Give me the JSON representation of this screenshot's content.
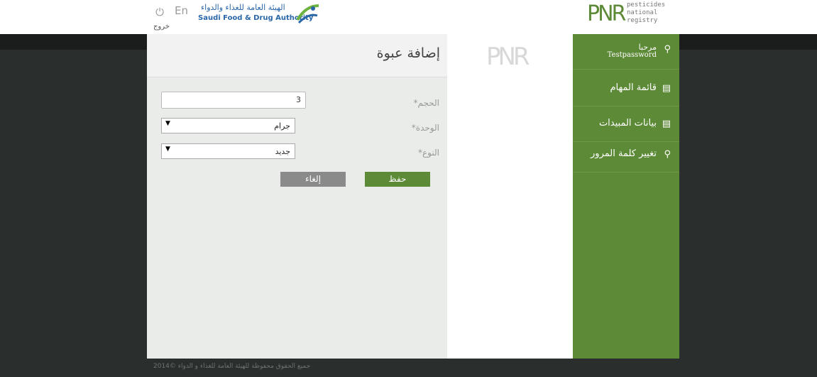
{
  "header": {
    "power_icon": "power-icon",
    "language_label": "En",
    "logout_label": "خروج",
    "sfda_name_ar": "الهيئة العامة للغذاء والدواء",
    "sfda_name_en": "Saudi Food & Drug Authority",
    "pnr_mark": "PNR",
    "pnr_words": [
      "pesticides",
      "national",
      "registry"
    ]
  },
  "sidebar": {
    "welcome_ar": "مرحبا",
    "welcome_user": "Testpassword",
    "items": [
      {
        "label": "قائمة المهام",
        "icon": "list-icon"
      },
      {
        "label": "بيانات المبيدات",
        "icon": "list-icon"
      },
      {
        "label": "تغيير كلمة المرور",
        "icon": "key-icon"
      }
    ]
  },
  "form": {
    "title": "إضافة عبوة",
    "fields": [
      {
        "label": "الحجم*",
        "value": "3"
      },
      {
        "label": "الوحدة*",
        "value": "جرام"
      },
      {
        "label": "النوع*",
        "value": "جديد"
      }
    ],
    "save_label": "حفظ",
    "cancel_label": "إلغاء"
  },
  "watermark": "PNR",
  "footer": {
    "copyright": "جميع الحقوق محفوظة للهيئة العامة للغذاء و الدواء ©2014"
  },
  "colors": {
    "accent_green": "#5d8a37",
    "background": "#2a2f2d"
  }
}
